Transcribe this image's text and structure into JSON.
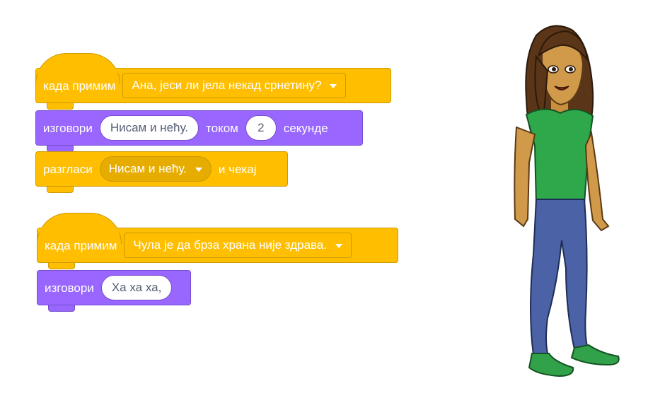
{
  "script1": {
    "hat": {
      "label": "када примим",
      "message": "Ана, јеси ли јела некад срнетину?"
    },
    "say": {
      "label": "изговори",
      "text": "Нисам и нећу.",
      "for_label": "током",
      "secs": "2",
      "secs_label": "секунде"
    },
    "broadcast": {
      "label": "разгласи",
      "message": "Нисам и нећу.",
      "wait_label": "и чекај"
    }
  },
  "script2": {
    "hat": {
      "label": "када примим",
      "message": "Чула је да брза храна није здрава."
    },
    "say": {
      "label": "изговори",
      "text": "Ха ха ха,"
    }
  },
  "colors": {
    "events": "#ffbf00",
    "looks": "#9966ff",
    "text_dark": "#575e75"
  },
  "sprite": {
    "icon": "girl-sprite-icon"
  }
}
